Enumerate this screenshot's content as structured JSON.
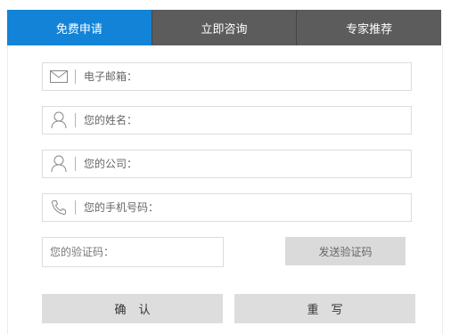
{
  "tabs": [
    {
      "label": "免费申请",
      "active": true
    },
    {
      "label": "立即咨询",
      "active": false
    },
    {
      "label": "专家推荐",
      "active": false
    }
  ],
  "form": {
    "email_placeholder": "电子邮箱：",
    "name_placeholder": "您的姓名：",
    "company_placeholder": "您的公司：",
    "phone_placeholder": "您的手机号码：",
    "code_placeholder": "您的验证码：",
    "send_code_label": "发送验证码",
    "confirm_label": "确认",
    "reset_label": "重写"
  },
  "icons": {
    "email": "envelope-icon",
    "name": "person-icon",
    "company": "person-icon",
    "phone": "phone-icon"
  },
  "colors": {
    "tab_active": "#1383d8",
    "tab_inactive": "#5c5c5c",
    "button_gray": "#dddddd"
  }
}
